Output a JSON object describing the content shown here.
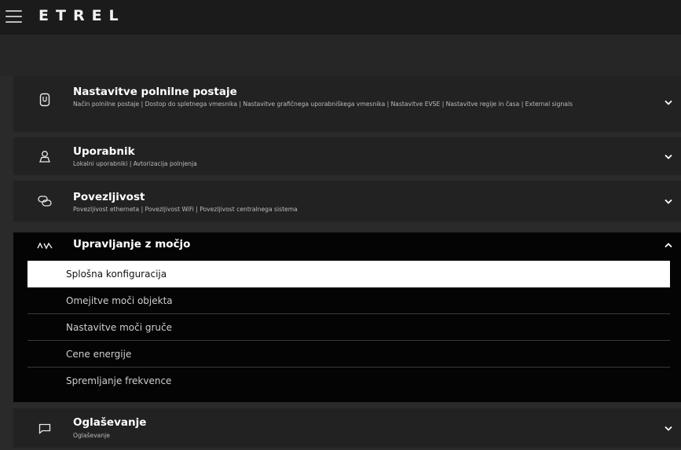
{
  "header": {
    "logo_text": "ETREL",
    "menu_icon": "hamburger-menu-icon"
  },
  "sections": [
    {
      "title": "Nastavitve polnilne postaje",
      "subtitle": "Način polnilne postaje  |  Dostop do spletnega vmesnika  |  Nastavitve grafičnega uporabniškega vmesnika  |  Nastavitve EVSE  |  Nastavitve regije in časa  |  External signals",
      "icon": "charging-station-icon",
      "expanded": false
    },
    {
      "title": "Uporabnik",
      "subtitle": "Lokalni uporabniki  |  Avtorizacija polnjenja",
      "icon": "user-icon",
      "expanded": false
    },
    {
      "title": "Povezljivost",
      "subtitle": "Povezljivost etherneta  |  Povezljivost WiFi  |  Povezljivost centralnega sistema",
      "icon": "link-icon",
      "expanded": false
    },
    {
      "title": "Upravljanje z močjo",
      "subtitle": "",
      "icon": "power-wave-icon",
      "expanded": true,
      "items": [
        "Splošna konfiguracija",
        "Omejitve moči objekta",
        "Nastavitve moči gruče",
        "Cene energije",
        "Spremljanje frekvence"
      ],
      "active_item": "Splošna konfiguracija"
    },
    {
      "title": "Oglaševanje",
      "subtitle": "Oglaševanje",
      "icon": "speech-bubble-icon",
      "expanded": false
    }
  ],
  "colors": {
    "topbar": "#1b1b1b",
    "background": "#2a2a2a",
    "section": "#222222",
    "expanded_section": "#040404",
    "active_item": "#ffffff"
  }
}
